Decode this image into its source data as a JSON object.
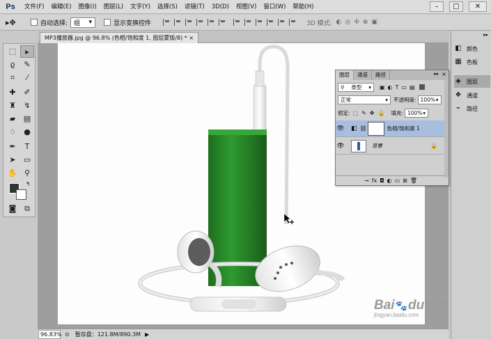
{
  "app": {
    "logo": "Ps"
  },
  "menu": [
    "文件(F)",
    "编辑(E)",
    "图像(I)",
    "图层(L)",
    "文字(Y)",
    "选择(S)",
    "滤镜(T)",
    "3D(D)",
    "视图(V)",
    "窗口(W)",
    "帮助(H)"
  ],
  "options": {
    "auto_select_label": "自动选择:",
    "auto_select_value": "组",
    "show_transform_label": "显示变换控件",
    "mode_3d_label": "3D 模式:"
  },
  "document": {
    "tab_title": "MP3播放器.jpg @ 96.8% (色相/饱和度 1, 图层蒙版/8) *",
    "tab_close": "×"
  },
  "status": {
    "zoom": "96.83%",
    "scratch": "暂存盘：121.8M/890.3M"
  },
  "dock": {
    "items": [
      "颜色",
      "色板",
      "图层",
      "通道",
      "路径"
    ]
  },
  "layers_panel": {
    "tabs": [
      "图层",
      "通道",
      "路径"
    ],
    "filter_label": "类型",
    "blend_mode": "正常",
    "opacity_label": "不透明度:",
    "opacity_value": "100%",
    "lock_label": "锁定:",
    "fill_label": "填充:",
    "fill_value": "100%",
    "layers": [
      {
        "name": "色相/饱和度 1"
      },
      {
        "name": "背景"
      }
    ]
  },
  "watermark": {
    "brand": "Bai",
    "brand2": "du",
    "product": "经验",
    "url": "jingyan.baidu.com"
  },
  "colors": {
    "accent": "#a8bedf",
    "device_green": "#2e8b2e"
  }
}
